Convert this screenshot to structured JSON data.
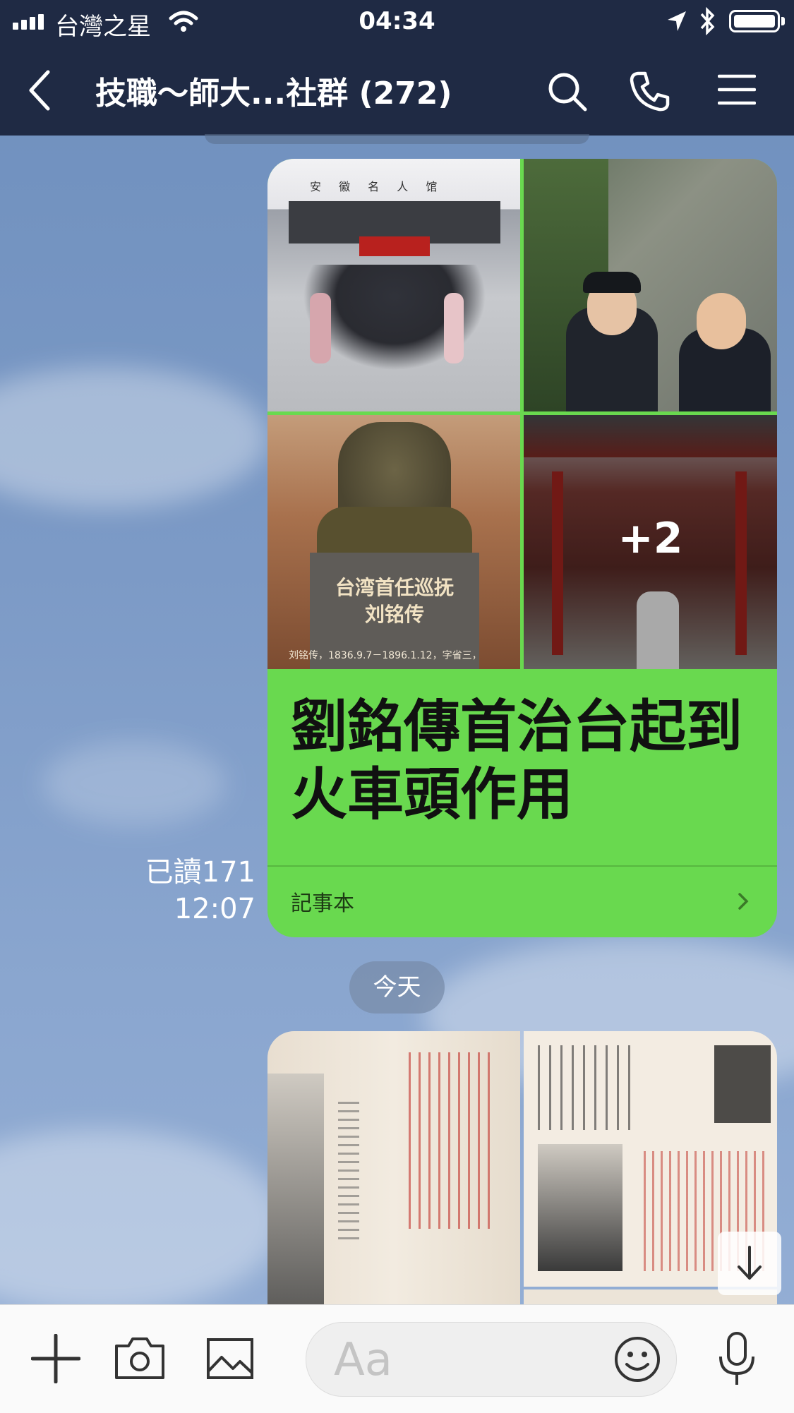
{
  "status_bar": {
    "carrier": "台灣之星",
    "time": "04:34"
  },
  "nav": {
    "title": "技職～師大...社群 (272)",
    "icons": [
      "back-chevron-icon",
      "search-icon",
      "phone-icon",
      "menu-icon"
    ]
  },
  "messages": [
    {
      "type": "note",
      "photo_overlay": "+2",
      "statue_caption_line1": "台湾首任巡抚",
      "statue_caption_line2": "刘铭传",
      "statue_small_text": "刘铭传，1836.9.7－1896.1.12，字省三，",
      "museum_sign": "安 徽 名 人 馆",
      "title": "劉銘傳首治台起到火車頭作用",
      "footer": "記事本",
      "read_label": "已讀171",
      "time": "12:07"
    }
  ],
  "date_separator": "今天",
  "input": {
    "placeholder": "Aa"
  },
  "colors": {
    "header": "#1f2a44",
    "bubble": "#69d94f",
    "chat_bg": "#7f9cc6"
  }
}
